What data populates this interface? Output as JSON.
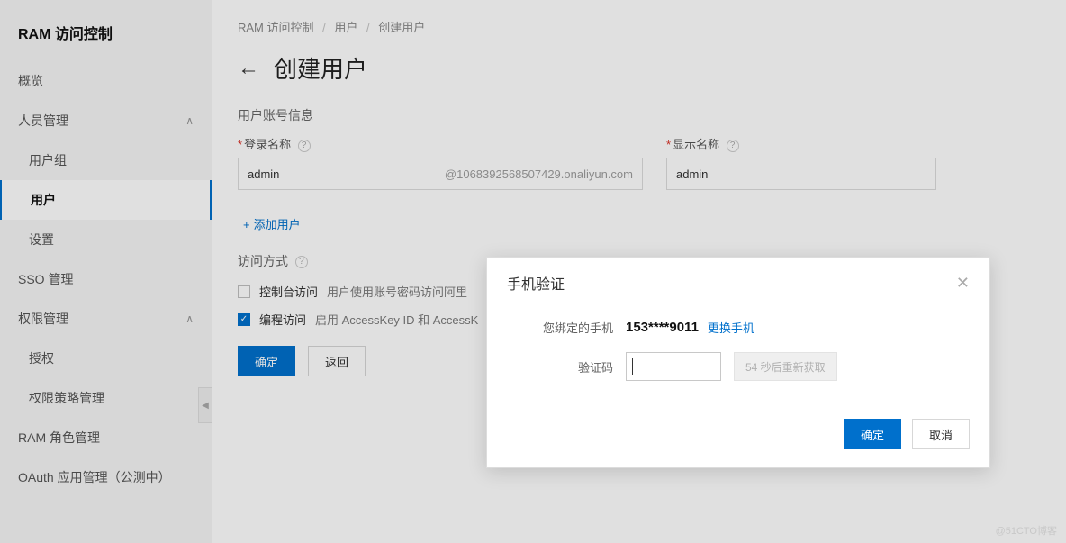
{
  "sidebar": {
    "title": "RAM 访问控制",
    "items": [
      {
        "label": "概览",
        "sub": false,
        "expandable": false
      },
      {
        "label": "人员管理",
        "sub": false,
        "expandable": true
      },
      {
        "label": "用户组",
        "sub": true,
        "expandable": false
      },
      {
        "label": "用户",
        "sub": true,
        "expandable": false,
        "active": true
      },
      {
        "label": "设置",
        "sub": true,
        "expandable": false
      },
      {
        "label": "SSO 管理",
        "sub": false,
        "expandable": false
      },
      {
        "label": "权限管理",
        "sub": false,
        "expandable": true
      },
      {
        "label": "授权",
        "sub": true,
        "expandable": false
      },
      {
        "label": "权限策略管理",
        "sub": true,
        "expandable": false
      },
      {
        "label": "RAM 角色管理",
        "sub": false,
        "expandable": false
      },
      {
        "label": "OAuth 应用管理（公测中）",
        "sub": false,
        "expandable": false
      }
    ]
  },
  "breadcrumb": {
    "root": "RAM 访问控制",
    "mid": "用户",
    "leaf": "创建用户"
  },
  "page": {
    "title": "创建用户",
    "section_label": "用户账号信息",
    "access_label": "访问方式"
  },
  "form": {
    "login_label": "登录名称",
    "login_value": "admin",
    "login_suffix": "@1068392568507429.onaliyun.com",
    "display_label": "显示名称",
    "display_value": "admin",
    "add_user": "添加用户"
  },
  "access": {
    "console": {
      "title": "控制台访问",
      "desc": "用户使用账号密码访问阿里",
      "checked": false
    },
    "program": {
      "title": "编程访问",
      "desc": "启用 AccessKey ID 和 AccessK",
      "checked": true
    }
  },
  "buttons": {
    "ok": "确定",
    "back": "返回"
  },
  "modal": {
    "title": "手机验证",
    "bound_label": "您绑定的手机",
    "phone": "153****9011",
    "change": "更换手机",
    "code_label": "验证码",
    "resend": "54 秒后重新获取",
    "ok": "确定",
    "cancel": "取消"
  },
  "watermark": "@51CTO博客"
}
